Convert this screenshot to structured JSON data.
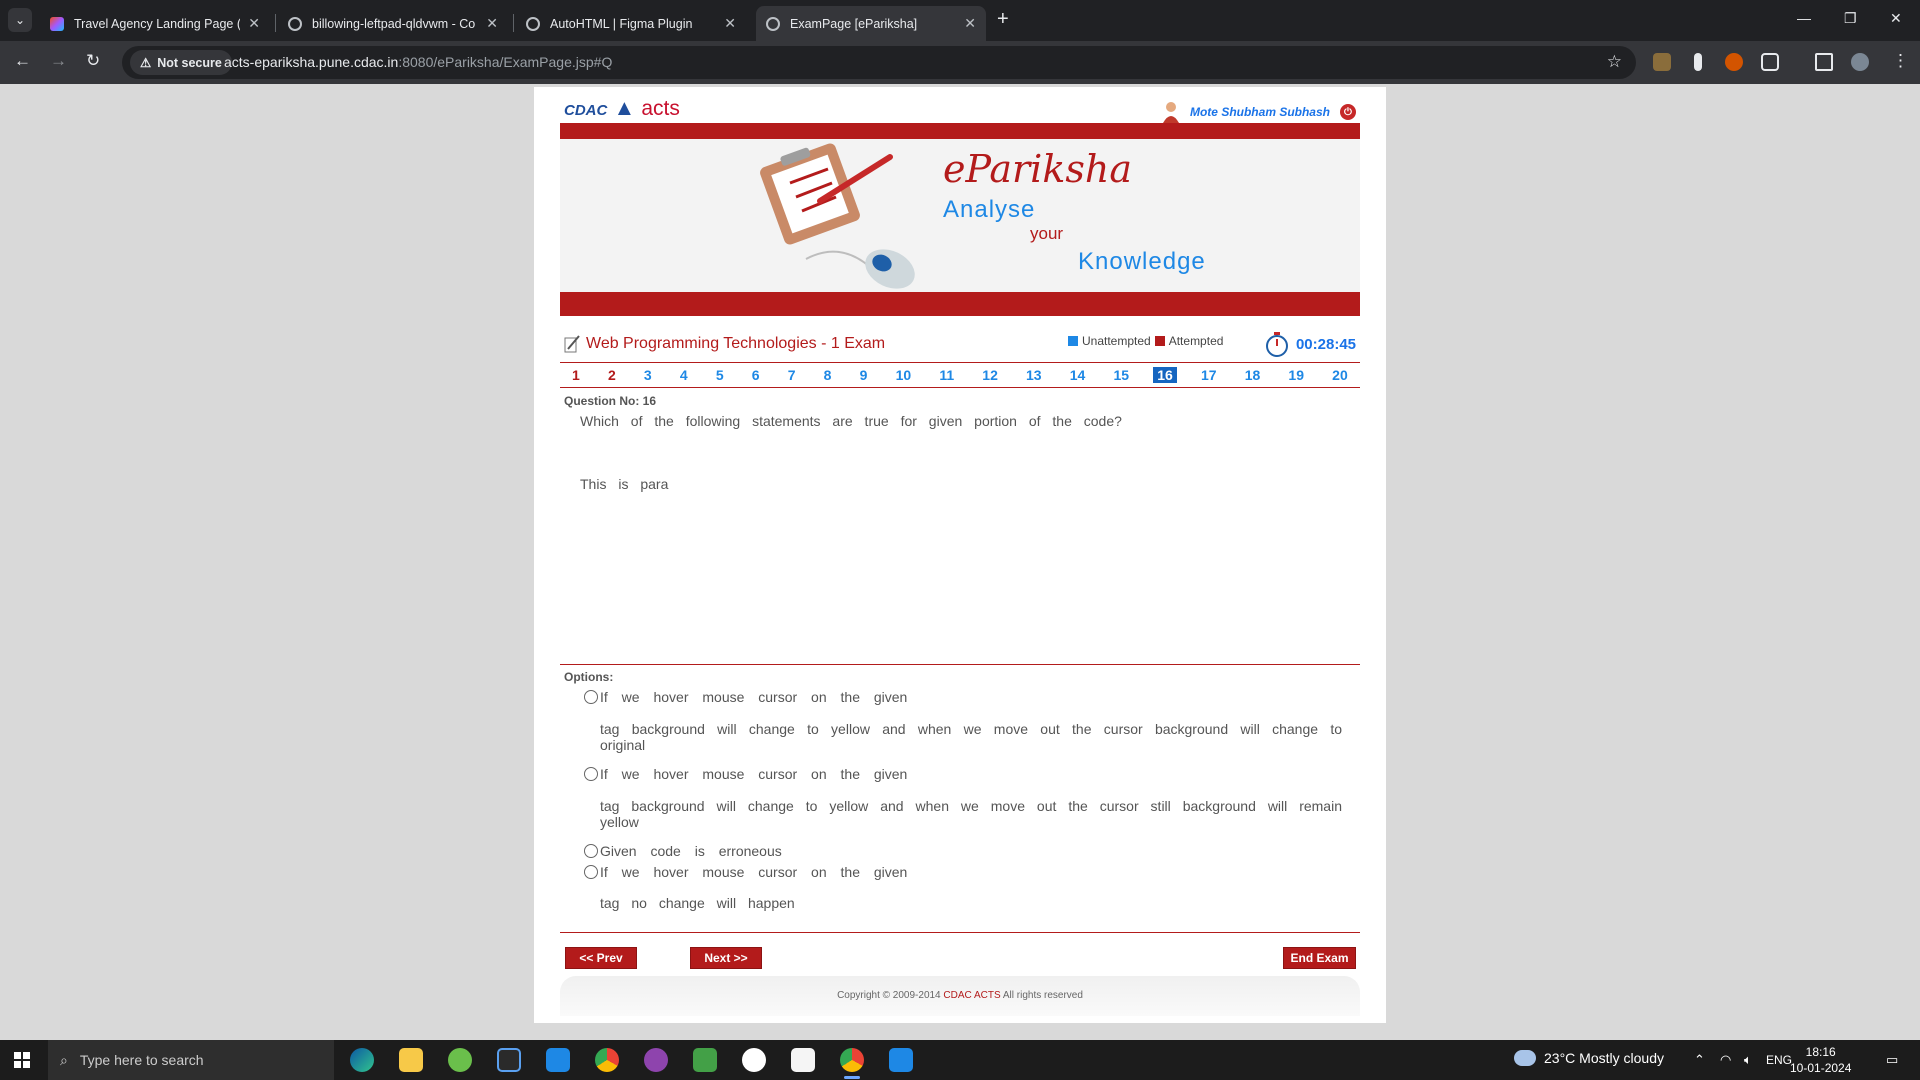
{
  "browser": {
    "tabs": [
      {
        "title": "Travel Agency Landing Page (Co",
        "active": false
      },
      {
        "title": "billowing-leftpad-qldvwm - Co",
        "active": false
      },
      {
        "title": "AutoHTML | Figma Plugin",
        "active": false
      },
      {
        "title": "ExamPage [eParikshа]",
        "active": true
      }
    ],
    "security_label": "Not secure",
    "url_host": "acts-epariksha.pune.cdac.in",
    "url_path": ":8080/ePariksha/ExamPage.jsp#Q"
  },
  "header": {
    "logo_cdac": "CDAC",
    "logo_acts": "acts",
    "username": "Mote Shubham Subhash"
  },
  "banner": {
    "title": "eParikshа",
    "line1": "Analyse",
    "line2": "your",
    "line3": "Knowledge"
  },
  "exam": {
    "title": "Web Programming Technologies - 1 Exam",
    "legend_unattempted": "Unattempted",
    "legend_attempted": "Attempted",
    "timer": "00:28:45",
    "colors": {
      "accent": "#b31b1b",
      "blue": "#1e88e5",
      "unattempted": "#1e88e5",
      "attempted": "#b31b1b"
    },
    "questions": [
      "1",
      "2",
      "3",
      "4",
      "5",
      "6",
      "7",
      "8",
      "9",
      "10",
      "11",
      "12",
      "13",
      "14",
      "15",
      "16",
      "17",
      "18",
      "19",
      "20"
    ],
    "current_question": "16",
    "visited": [
      "1",
      "2"
    ]
  },
  "question": {
    "number_label": "Question No: 16",
    "text": "Which of the following statements are true for given portion of the code?",
    "para": "This is para"
  },
  "options": {
    "label": "Options:",
    "a_line1": "If we hover mouse cursor on the given",
    "a_line2": "tag background will change to yellow and when we move out the cursor background will change to original",
    "b_line1": "If we hover mouse cursor on the given",
    "b_line2": "tag background will change to yellow and when we move out the cursor still background will remain yellow",
    "c_line1": "Given code is erroneous",
    "d_line1": "If we hover mouse cursor on the given",
    "d_line2": "tag no change will happen"
  },
  "nav": {
    "prev": "<< Prev",
    "next": "Next >>",
    "end": "End Exam"
  },
  "footer": {
    "copyright_prefix": "Copyright © 2009-2014",
    "brand": "CDAC ACTS",
    "suffix": "All rights reserved"
  },
  "taskbar": {
    "search_placeholder": "Type here to search",
    "weather": "23°C  Mostly cloudy",
    "lang": "ENG",
    "time": "18:16",
    "date": "10-01-2024"
  }
}
